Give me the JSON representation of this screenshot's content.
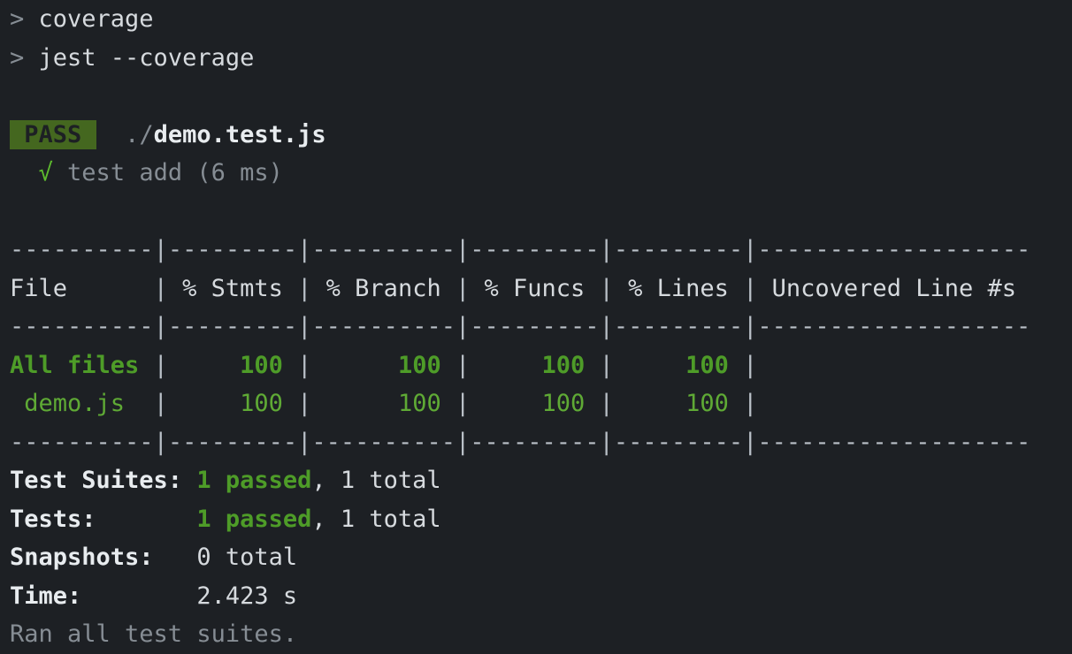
{
  "terminal": {
    "background_color": "#1d2024",
    "foreground_color": "#d6dade",
    "dim_color": "#868d94",
    "green_color": "#57a333",
    "pass_badge_bg": "#44671f",
    "pass_badge_fg": "#1d2024"
  },
  "prompt": {
    "symbol": "> ",
    "line1_command": "coverage",
    "line2_command": "jest --coverage"
  },
  "suite": {
    "status_badge": " PASS ",
    "path_prefix": "./",
    "path_file": "demo.test.js",
    "check_glyph": "√",
    "test_name": "test add",
    "test_duration": "(6 ms)"
  },
  "coverage_table": {
    "rule_file": "----------",
    "rule_stmts": "---------",
    "rule_branch": "----------",
    "rule_funcs": "---------",
    "rule_lines": "---------",
    "rule_uncovered": "-------------------",
    "pipe": "|",
    "headers": {
      "file": "File      ",
      "stmts": " % Stmts ",
      "branch": " % Branch ",
      "funcs": " % Funcs ",
      "lines": " % Lines ",
      "uncovered": " Uncovered Line #s"
    },
    "rows": [
      {
        "name": "All files",
        "name_cell": "All files ",
        "bold": true,
        "stmts": "     100 ",
        "branch": "      100 ",
        "funcs": "     100 ",
        "lines": "     100 ",
        "uncovered": " "
      },
      {
        "name": "demo.js",
        "name_cell": " demo.js  ",
        "bold": false,
        "stmts": "     100 ",
        "branch": "      100 ",
        "funcs": "     100 ",
        "lines": "     100 ",
        "uncovered": " "
      }
    ]
  },
  "summary": {
    "test_suites_label": "Test Suites: ",
    "test_suites_passed": "1 passed",
    "test_suites_rest": ", 1 total",
    "tests_label": "Tests:       ",
    "tests_passed": "1 passed",
    "tests_rest": ", 1 total",
    "snapshots_label": "Snapshots:   ",
    "snapshots_value": "0 total",
    "time_label": "Time:        ",
    "time_value": "2.423 s",
    "footer": "Ran all test suites."
  },
  "chart_data": {
    "type": "table",
    "title": "Jest Coverage Summary",
    "columns": [
      "File",
      "% Stmts",
      "% Branch",
      "% Funcs",
      "% Lines",
      "Uncovered Line #s"
    ],
    "rows": [
      [
        "All files",
        100,
        100,
        100,
        100,
        ""
      ],
      [
        "demo.js",
        100,
        100,
        100,
        100,
        ""
      ]
    ]
  }
}
